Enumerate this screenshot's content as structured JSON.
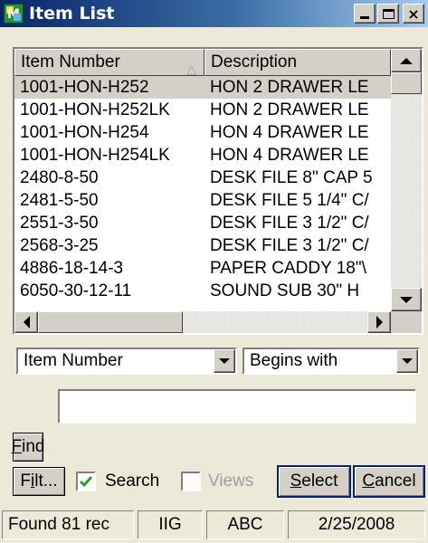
{
  "window": {
    "title": "Item List",
    "icon": "item-list-app-icon",
    "controls": [
      "minimize",
      "maximize",
      "close"
    ]
  },
  "grid": {
    "columns": [
      {
        "label": "Item Number",
        "sorted": "ascending"
      },
      {
        "label": "Description"
      }
    ],
    "rows": [
      {
        "item_number": "1001-HON-H252",
        "description": "HON 2 DRAWER LE",
        "selected": true
      },
      {
        "item_number": "1001-HON-H252LK",
        "description": "HON 2 DRAWER LE"
      },
      {
        "item_number": "1001-HON-H254",
        "description": "HON 4 DRAWER LE"
      },
      {
        "item_number": "1001-HON-H254LK",
        "description": "HON 4 DRAWER LE"
      },
      {
        "item_number": "2480-8-50",
        "description": "DESK FILE 8\" CAP 5"
      },
      {
        "item_number": "2481-5-50",
        "description": "DESK FILE 5 1/4\" C/"
      },
      {
        "item_number": "2551-3-50",
        "description": "DESK FILE 3 1/2\" C/"
      },
      {
        "item_number": "2568-3-25",
        "description": "DESK FILE 3 1/2\" C/"
      },
      {
        "item_number": "4886-18-14-3",
        "description": "PAPER CADDY 18\"\\"
      },
      {
        "item_number": "6050-30-12-11",
        "description": "SOUND SUB 30\" H"
      }
    ]
  },
  "search": {
    "field_select": "Item Number",
    "operator_select": "Begins with",
    "value": ""
  },
  "buttons": {
    "find": {
      "label": "Find",
      "mnemonic": "F",
      "rest": "ind"
    },
    "filter": {
      "label": "Filt...",
      "mnemonic": "i",
      "pre": "F",
      "rest": "lt..."
    },
    "select": {
      "label": "Select",
      "mnemonic": "S",
      "rest": "elect"
    },
    "cancel": {
      "label": "Cancel",
      "mnemonic": "C",
      "rest": "ancel"
    }
  },
  "options": {
    "search_label": "Search",
    "search_checked": true,
    "views_label": "Views",
    "views_checked": false,
    "views_enabled": false
  },
  "status": {
    "found": "Found 81 rec",
    "company": "IIG",
    "code": "ABC",
    "date": "2/25/2008"
  }
}
